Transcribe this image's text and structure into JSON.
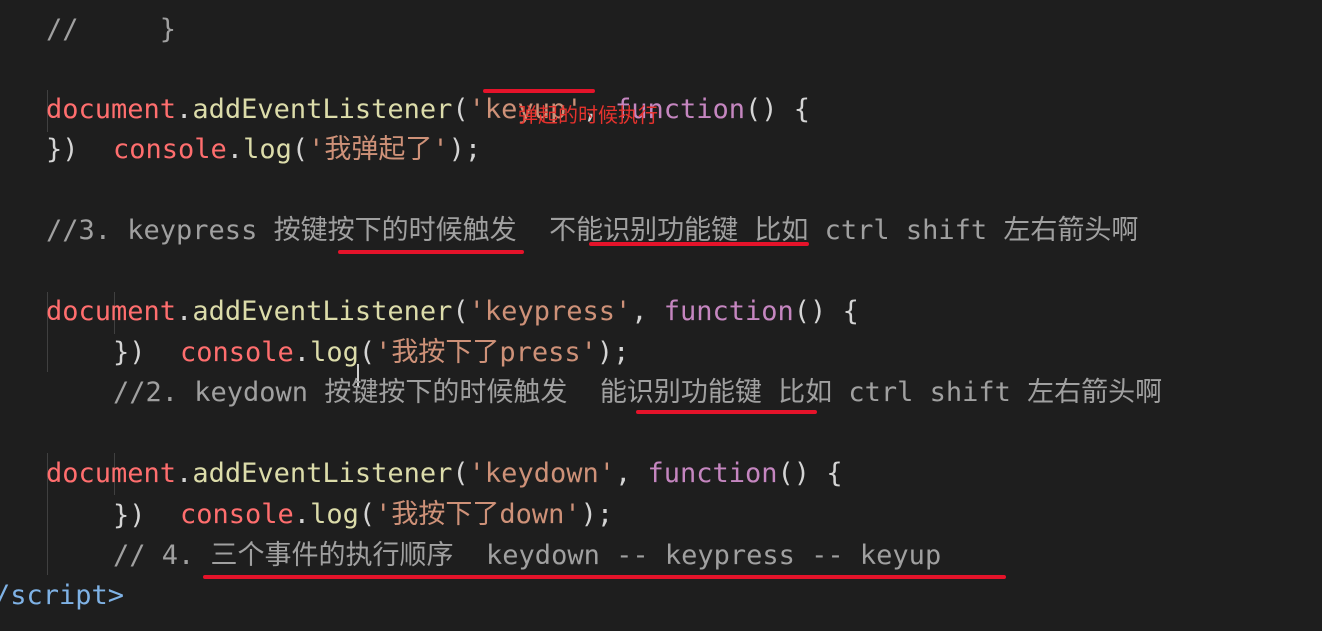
{
  "lines": [
    {
      "indent": "//     }"
    },
    {
      "l2_a": "document",
      "l2_b": ".",
      "l2_c": "addEventListener",
      "l2_d": "(",
      "l2_e": "'keyup'",
      "l2_f": ", ",
      "l2_g": "function",
      "l2_h": "() {"
    },
    {
      "l3_a": "console",
      "l3_b": ".",
      "l3_c": "log",
      "l3_d": "(",
      "l3_e": "'我弹起了'",
      "l3_f": ");"
    },
    {
      "l4": "})"
    },
    {
      "l6": "//3. keypress 按键按下的时候触发  不能识别功能键 比如 ctrl shift 左右箭头啊"
    },
    {
      "l7_a": "document",
      "l7_b": ".",
      "l7_c": "addEventListener",
      "l7_d": "(",
      "l7_e": "'keypress'",
      "l7_f": ", ",
      "l7_g": "function",
      "l7_h": "() {"
    },
    {
      "l8_a": "console",
      "l8_b": ".",
      "l8_c": "log",
      "l8_d": "(",
      "l8_e": "'我按下了press'",
      "l8_f": ");"
    },
    {
      "l9": "})"
    },
    {
      "l10": "//2. keydown 按键按下的时候触发  能识别功能键 比如 ctrl shift 左右箭头啊"
    },
    {
      "l11_a": "document",
      "l11_b": ".",
      "l11_c": "addEventListener",
      "l11_d": "(",
      "l11_e": "'keydown'",
      "l11_f": ", ",
      "l11_g": "function",
      "l11_h": "() {"
    },
    {
      "l12_a": "console",
      "l12_b": ".",
      "l12_c": "log",
      "l12_d": "(",
      "l12_e": "'我按下了down'",
      "l12_f": ");"
    },
    {
      "l13": "})"
    },
    {
      "l14": "// 4. 三个事件的执行顺序  keydown -- keypress -- keyup"
    },
    {
      "l15": "/script>"
    }
  ],
  "annotation": "弹起的时候执行",
  "colors": {
    "background": "#1e1e1e",
    "underline": "#e5132a",
    "annotation": "#e5322d"
  }
}
